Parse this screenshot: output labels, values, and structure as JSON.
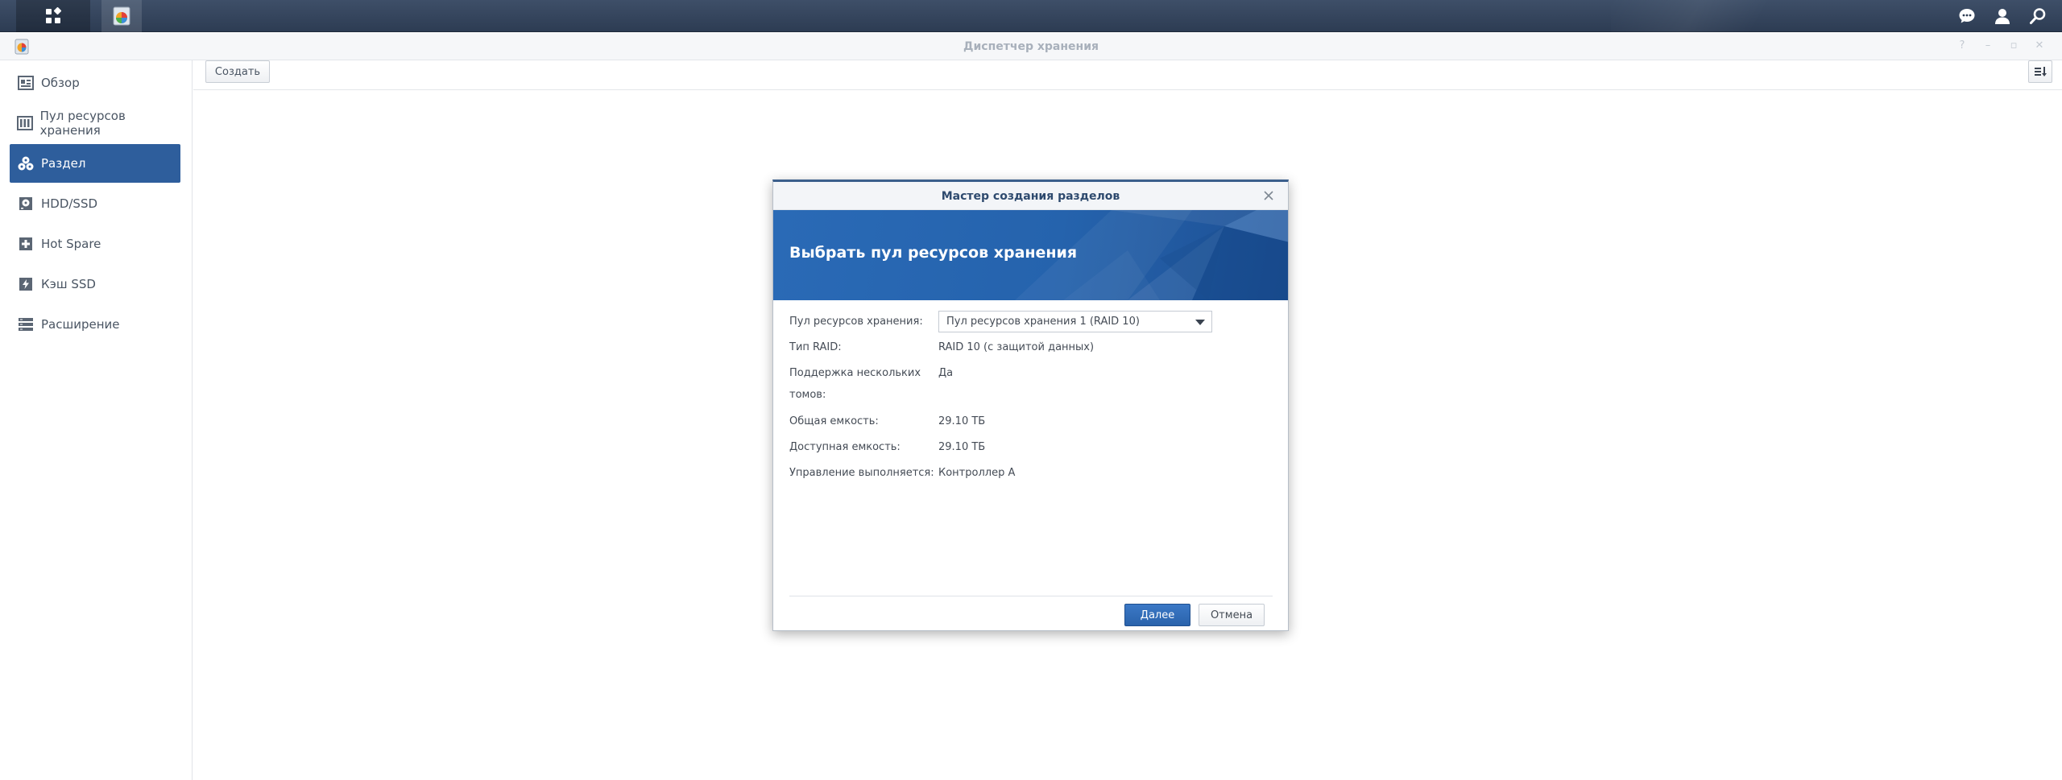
{
  "window": {
    "title": "Диспетчер хранения"
  },
  "toolbar": {
    "create_label": "Создать"
  },
  "sidebar": {
    "items": [
      {
        "label": "Обзор",
        "icon": "overview-icon"
      },
      {
        "label": "Пул ресурсов хранения",
        "icon": "storage-pool-icon"
      },
      {
        "label": "Раздел",
        "icon": "volume-icon",
        "active": true
      },
      {
        "label": "HDD/SSD",
        "icon": "hdd-icon"
      },
      {
        "label": "Hot Spare",
        "icon": "hot-spare-icon"
      },
      {
        "label": "Кэш SSD",
        "icon": "ssd-cache-icon"
      },
      {
        "label": "Расширение",
        "icon": "expansion-icon"
      }
    ]
  },
  "wizard": {
    "title": "Мастер создания разделов",
    "step_title": "Выбрать пул ресурсов хранения",
    "fields": {
      "pool_label": "Пул ресурсов хранения:",
      "pool_value": "Пул ресурсов хранения 1 (RAID 10)",
      "raid_label": "Тип RAID:",
      "raid_value": "RAID 10 (с защитой данных)",
      "multi_label_line1": "Поддержка нескольких",
      "multi_label_line2": "томов:",
      "multi_value": "Да",
      "total_label": "Общая емкость:",
      "total_value": "29.10 ТБ",
      "avail_label": "Доступная емкость:",
      "avail_value": "29.10 ТБ",
      "managed_label": "Управление выполняется:",
      "managed_value": "Контроллер A"
    },
    "next_label": "Далее",
    "cancel_label": "Отмена"
  },
  "colors": {
    "taskbar": "#2d3c53",
    "accent": "#2e5e9c",
    "banner": "#2563ad",
    "primary_button": "#2a63ac"
  }
}
